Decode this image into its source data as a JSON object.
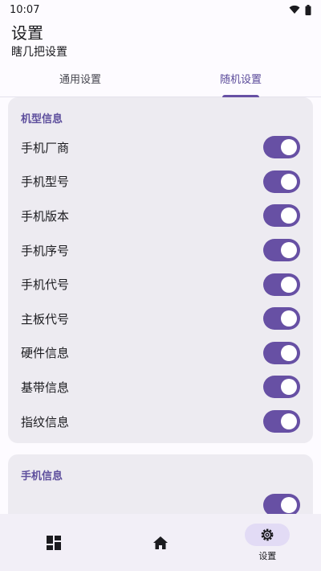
{
  "status_bar": {
    "time": "10:07",
    "icons": [
      "wifi-icon",
      "battery-icon"
    ]
  },
  "header": {
    "title": "设置",
    "subtitle": "瞎几把设置"
  },
  "tabs": [
    {
      "label": "通用设置",
      "active": false
    },
    {
      "label": "随机设置",
      "active": true
    }
  ],
  "sections": [
    {
      "title": "机型信息",
      "items": [
        {
          "label": "手机厂商",
          "on": true
        },
        {
          "label": "手机型号",
          "on": true
        },
        {
          "label": "手机版本",
          "on": true
        },
        {
          "label": "手机序号",
          "on": true
        },
        {
          "label": "手机代号",
          "on": true
        },
        {
          "label": "主板代号",
          "on": true
        },
        {
          "label": "硬件信息",
          "on": true
        },
        {
          "label": "基带信息",
          "on": true
        },
        {
          "label": "指纹信息",
          "on": true
        }
      ]
    },
    {
      "title": "手机信息",
      "items": [
        {
          "label": "",
          "on": true
        }
      ]
    }
  ],
  "bottom_nav": [
    {
      "icon": "dashboard-icon",
      "label": "",
      "active": false
    },
    {
      "icon": "home-icon",
      "label": "",
      "active": false
    },
    {
      "icon": "gear-icon",
      "label": "设置",
      "active": true
    }
  ],
  "colors": {
    "accent": "#6750a4",
    "card": "#edebf1",
    "section_title": "#5e4f9d"
  }
}
